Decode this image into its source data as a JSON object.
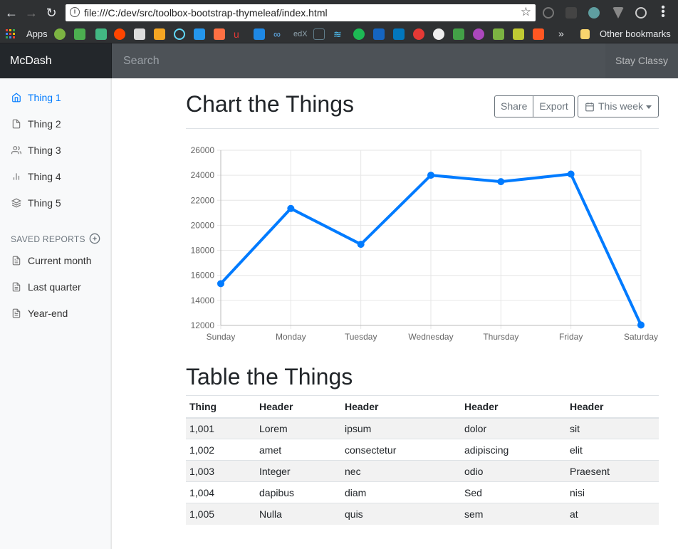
{
  "browser": {
    "url": "file:///C:/dev/src/toolbox-bootstrap-thymeleaf/index.html",
    "bookmarks": {
      "apps_label": "Apps",
      "other_label": "Other bookmarks",
      "overflow": "»"
    }
  },
  "navbar": {
    "brand": "McDash",
    "search_placeholder": "Search",
    "signout": "Stay Classy"
  },
  "sidebar": {
    "items": [
      {
        "label": "Thing 1",
        "icon": "home-icon",
        "active": true
      },
      {
        "label": "Thing 2",
        "icon": "file-icon"
      },
      {
        "label": "Thing 3",
        "icon": "users-icon"
      },
      {
        "label": "Thing 4",
        "icon": "bar-chart-icon"
      },
      {
        "label": "Thing 5",
        "icon": "layers-icon"
      }
    ],
    "saved_heading": "SAVED REPORTS",
    "reports": [
      {
        "label": "Current month",
        "icon": "file-text-icon"
      },
      {
        "label": "Last quarter",
        "icon": "file-text-icon"
      },
      {
        "label": "Year-end",
        "icon": "file-text-icon"
      }
    ]
  },
  "main": {
    "title": "Chart the Things",
    "share": "Share",
    "export": "Export",
    "period": "This week",
    "table_title": "Table the Things"
  },
  "chart_data": {
    "type": "line",
    "categories": [
      "Sunday",
      "Monday",
      "Tuesday",
      "Wednesday",
      "Thursday",
      "Friday",
      "Saturday"
    ],
    "series": [
      {
        "values": [
          15339,
          21345,
          18483,
          24003,
          23489,
          24092,
          12034
        ]
      }
    ],
    "ylim": [
      12000,
      26000
    ],
    "yticks": [
      12000,
      14000,
      16000,
      18000,
      20000,
      22000,
      24000,
      26000
    ],
    "grid": true,
    "color": "#007bff"
  },
  "table": {
    "headers": [
      "Thing",
      "Header",
      "Header",
      "Header",
      "Header"
    ],
    "rows": [
      [
        "1,001",
        "Lorem",
        "ipsum",
        "dolor",
        "sit"
      ],
      [
        "1,002",
        "amet",
        "consectetur",
        "adipiscing",
        "elit"
      ],
      [
        "1,003",
        "Integer",
        "nec",
        "odio",
        "Praesent"
      ],
      [
        "1,004",
        "dapibus",
        "diam",
        "Sed",
        "nisi"
      ],
      [
        "1,005",
        "Nulla",
        "quis",
        "sem",
        "at"
      ]
    ]
  }
}
